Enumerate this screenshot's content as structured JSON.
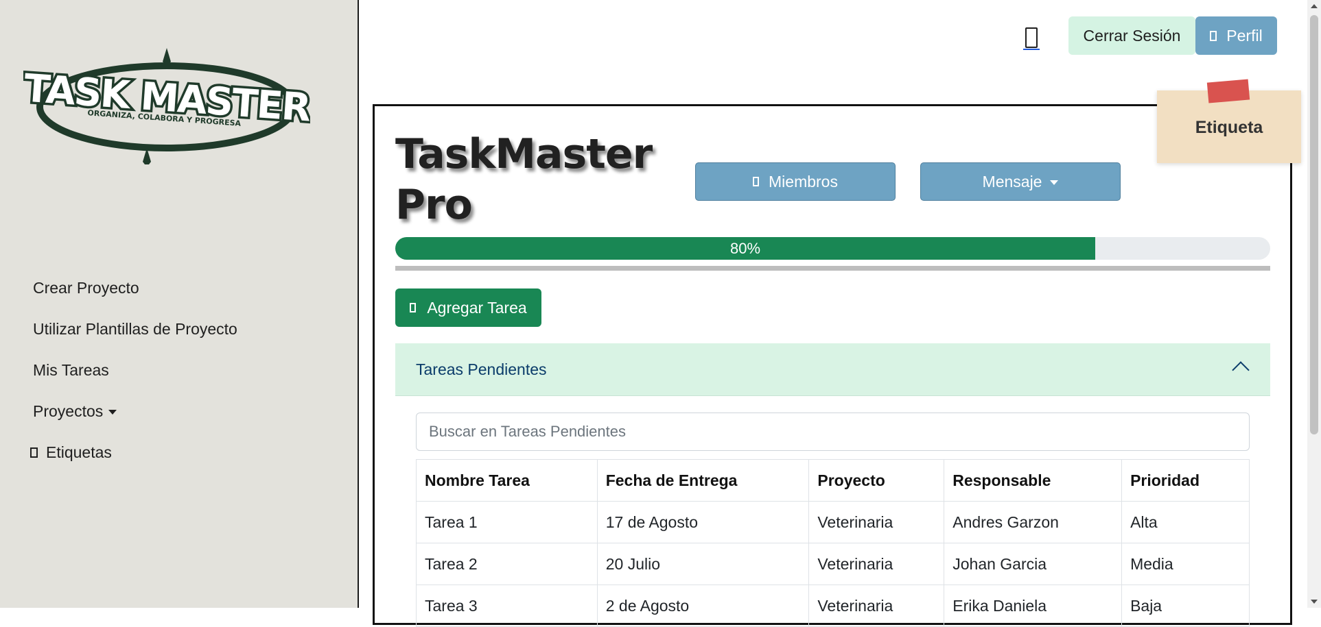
{
  "brand": {
    "logo_title": "TASK MASTER",
    "logo_tagline": "ORGANIZA, COLABORA Y PROGRESA",
    "logo_color": "#1f3a2a"
  },
  "sidebar": {
    "items": [
      {
        "label": "Crear Proyecto"
      },
      {
        "label": "Utilizar Plantillas de Proyecto"
      },
      {
        "label": "Mis Tareas"
      },
      {
        "label": "Proyectos"
      },
      {
        "label": "Etiquetas"
      }
    ]
  },
  "topbar": {
    "logout_label": "Cerrar Sesión",
    "profile_label": "Perfil",
    "icons": [
      "mobile-icon",
      "user-icon"
    ]
  },
  "project": {
    "title_line1": "TaskMaster",
    "title_line2": "Pro",
    "members_label": "Miembros",
    "message_label": "Mensaje",
    "progress": 80,
    "progress_label": "80%",
    "add_task_label": "Agregar Tarea",
    "sticky_label": "Etiqueta"
  },
  "pending": {
    "header": "Tareas Pendientes",
    "search_placeholder": "Buscar en Tareas Pendientes",
    "columns": [
      "Nombre Tarea",
      "Fecha de Entrega",
      "Proyecto",
      "Responsable",
      "Prioridad"
    ],
    "rows": [
      [
        "Tarea 1",
        "17 de Agosto",
        "Veterinaria",
        "Andres Garzon",
        "Alta"
      ],
      [
        "Tarea 2",
        "20 Julio",
        "Veterinaria",
        "Johan Garcia",
        "Media"
      ],
      [
        "Tarea 3",
        "2 de Agosto",
        "Veterinaria",
        "Erika Daniela",
        "Baja"
      ]
    ]
  },
  "colors": {
    "sidebar_bg": "#e3e2dc",
    "accent_blue": "#6ea3c3",
    "accent_green": "#198754",
    "mint": "#d9f3e4",
    "sticky": "#f2dfc2",
    "tape": "#d9534f"
  }
}
